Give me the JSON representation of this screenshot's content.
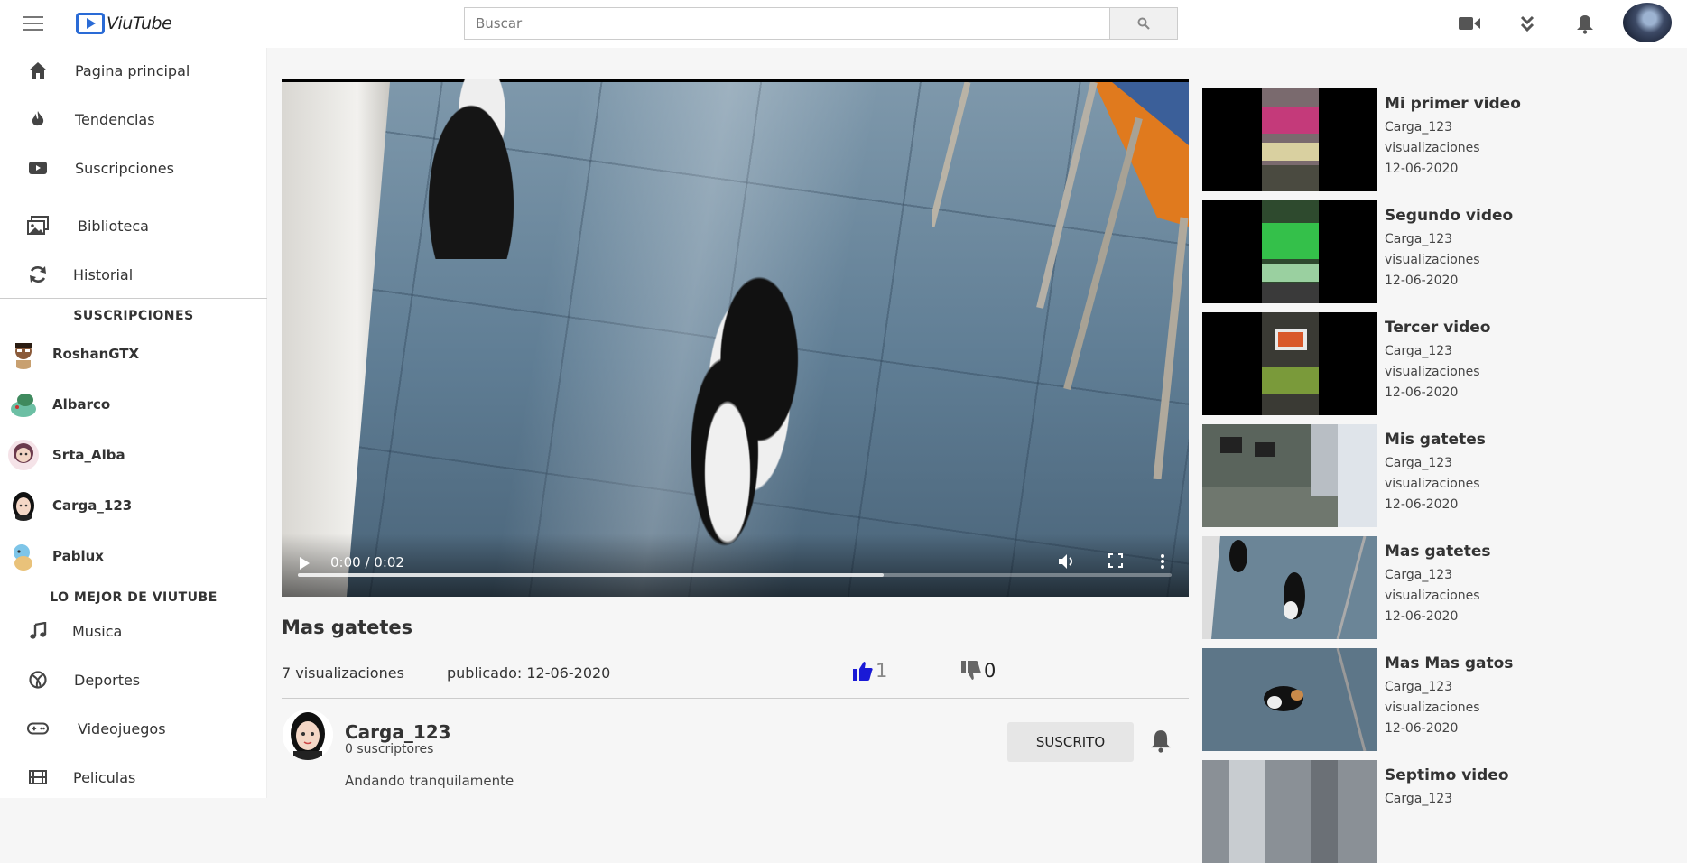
{
  "app": {
    "name": "ViuTube"
  },
  "search": {
    "placeholder": "Buscar"
  },
  "sidebar": {
    "main": [
      {
        "label": "Pagina principal",
        "icon": "home-icon"
      },
      {
        "label": "Tendencias",
        "icon": "flame-icon"
      },
      {
        "label": "Suscripciones",
        "icon": "subscriptions-icon"
      }
    ],
    "library": [
      {
        "label": "Biblioteca",
        "icon": "library-icon"
      },
      {
        "label": "Historial",
        "icon": "history-icon"
      }
    ],
    "subs_title": "SUSCRIPCIONES",
    "subs": [
      {
        "name": "RoshanGTX"
      },
      {
        "name": "Albarco"
      },
      {
        "name": "Srta_Alba"
      },
      {
        "name": "Carga_123"
      },
      {
        "name": "Pablux"
      }
    ],
    "best_title": "LO MEJOR DE VIUTUBE",
    "best": [
      {
        "label": "Musica",
        "icon": "music-icon"
      },
      {
        "label": "Deportes",
        "icon": "sports-icon"
      },
      {
        "label": "Videojuegos",
        "icon": "gamepad-icon"
      },
      {
        "label": "Peliculas",
        "icon": "film-icon"
      }
    ]
  },
  "player": {
    "time": "0:00 / 0:02",
    "progress": 0.67
  },
  "video": {
    "title": "Mas gatetes",
    "views": "7 visualizaciones",
    "published": "publicado: 12-06-2020",
    "likes": "1",
    "dislikes": "0",
    "like_color": "#1a1ad6"
  },
  "channel": {
    "name": "Carga_123",
    "subscribers": "0 suscriptores",
    "description": "Andando tranquilamente",
    "subscribe_label": "SUSCRITO"
  },
  "recommended": [
    {
      "title": "Mi primer video",
      "channel": "Carga_123",
      "views": "visualizaciones",
      "date": "12-06-2020"
    },
    {
      "title": "Segundo video",
      "channel": "Carga_123",
      "views": "visualizaciones",
      "date": "12-06-2020"
    },
    {
      "title": "Tercer video",
      "channel": "Carga_123",
      "views": "visualizaciones",
      "date": "12-06-2020"
    },
    {
      "title": "Mis gatetes",
      "channel": "Carga_123",
      "views": "visualizaciones",
      "date": "12-06-2020"
    },
    {
      "title": "Mas gatetes",
      "channel": "Carga_123",
      "views": "visualizaciones",
      "date": "12-06-2020"
    },
    {
      "title": "Mas Mas gatos",
      "channel": "Carga_123",
      "views": "visualizaciones",
      "date": "12-06-2020"
    },
    {
      "title": "Septimo video",
      "channel": "Carga_123"
    }
  ]
}
